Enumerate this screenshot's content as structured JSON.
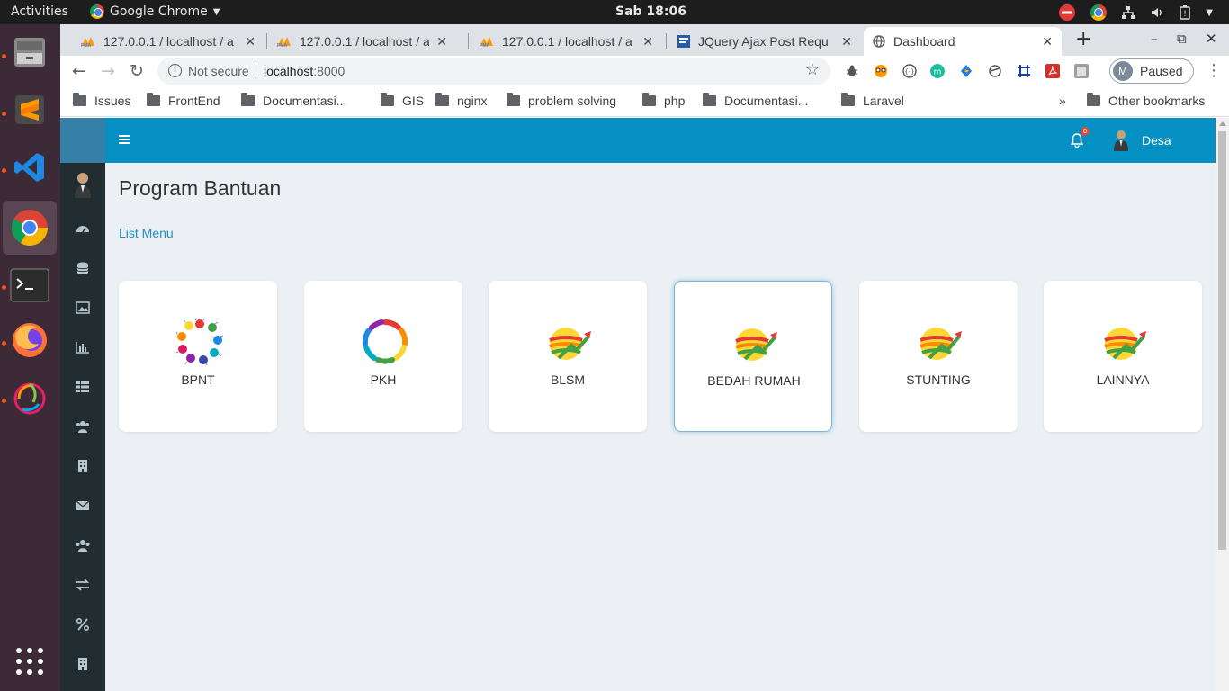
{
  "os": {
    "activities": "Activities",
    "app_menu": "Google Chrome",
    "clock": "Sab 18:06"
  },
  "dock": {
    "items": [
      "file-manager",
      "sublime-text",
      "vscode",
      "chrome",
      "terminal",
      "firefox",
      "deepin-app",
      "show-apps"
    ]
  },
  "browser": {
    "tabs": [
      {
        "title": "127.0.0.1 / localhost / a",
        "icon": "phpmyadmin-icon"
      },
      {
        "title": "127.0.0.1 / localhost / a",
        "icon": "phpmyadmin-icon"
      },
      {
        "title": "127.0.0.1 / localhost / a",
        "icon": "phpmyadmin-icon"
      },
      {
        "title": "JQuery Ajax Post Requ",
        "icon": "site-icon"
      },
      {
        "title": "Dashboard",
        "icon": "globe-icon"
      }
    ],
    "new_tab": "+",
    "minimize": "–",
    "maximize": "⧉",
    "close": "✕",
    "not_secure": "Not secure",
    "url_host": "localhost",
    "url_port": ":8000",
    "profile_initial": "M",
    "profile_status": "Paused",
    "bookmarks": [
      "Issues",
      "FrontEnd",
      "Documentasi...",
      "GIS",
      "nginx",
      "problem solving",
      "php",
      "Documentasi...",
      "Laravel"
    ],
    "bookmarks_overflow": "»",
    "other_bookmarks": "Other bookmarks"
  },
  "app": {
    "notification_count": "0",
    "user_name": "Desa",
    "page_title": "Program Bantuan",
    "breadcrumb_link": "List Menu",
    "sidebar_icons": [
      "dashboard-icon",
      "database-icon",
      "image-icon",
      "bar-chart-icon",
      "grid-icon",
      "users-icon",
      "building-icon",
      "envelope-icon",
      "group-icon",
      "exchange-icon",
      "percent-icon",
      "office-icon"
    ],
    "cards": [
      {
        "label": "BPNT",
        "logo": "hands-circle-logo"
      },
      {
        "label": "PKH",
        "logo": "pkh-ring-logo"
      },
      {
        "label": "BLSM",
        "logo": "growth-globe-logo"
      },
      {
        "label": "BEDAH RUMAH",
        "logo": "growth-globe-logo"
      },
      {
        "label": "STUNTING",
        "logo": "growth-globe-logo"
      },
      {
        "label": "LAINNYA",
        "logo": "growth-globe-logo"
      }
    ]
  },
  "colors": {
    "header": "#0590c3",
    "sidebar": "#222d32",
    "sidebar_logo": "#367fa9",
    "content_bg": "#ecf0f5",
    "link": "#1d8fc1",
    "badge": "#dd4b39"
  }
}
